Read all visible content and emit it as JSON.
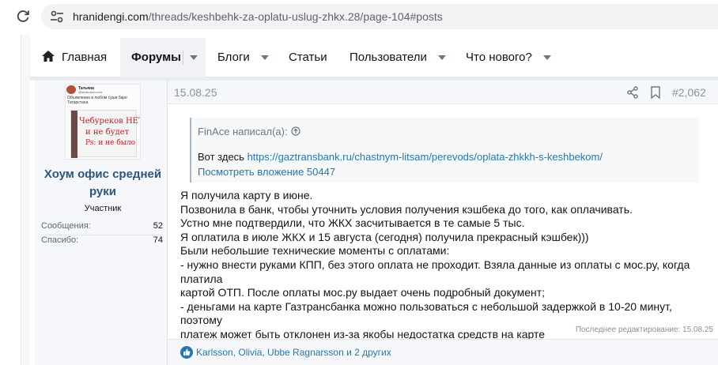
{
  "browser": {
    "url_domain": "hranidengi.com",
    "url_path": "/threads/keshbehk-za-oplatu-uslug-zhkx.28/page-104#posts"
  },
  "nav": {
    "home": "Главная",
    "forums": "Форумы",
    "blogs": "Блоги",
    "articles": "Статьи",
    "users": "Пользователи",
    "whats_new": "Что нового?"
  },
  "author": {
    "avatar_text": {
      "name": "Татьяна",
      "handle": "@tanikodonovna",
      "caption": "Объявление в любом суши баре Татарстана",
      "sign_line1": "Чебуреков НЕТ",
      "sign_line2": "и не будет",
      "sign_line3": "Ps: и не было"
    },
    "name": "Хоум офис средней руки",
    "title": "Участник",
    "stats": [
      {
        "label": "Сообщения:",
        "value": "52"
      },
      {
        "label": "Спасибо:",
        "value": "74"
      }
    ]
  },
  "post": {
    "date": "15.08.25",
    "number": "#2,062",
    "quote": {
      "author_line": "FinAce написал(а):",
      "text_prefix": "Вот здесь ",
      "link": "https://gaztransbank.ru/chastnym-litsam/perevods/oplata-zhkkh-s-keshbekom/",
      "attachment": "Посмотреть вложение 50447"
    },
    "body": [
      "Я получила карту в июне.",
      "Позвонила в банк, чтобы уточнить условия получения кэшбека до того, как оплачивать.",
      "Устно мне подтвердили, что ЖКХ засчитывается в те самые 5 тыс.",
      "Я оплатила в июле ЖКХ и 15 августа (сегодня) получила прекрасный кэшбек)))",
      "Были небольшие технические моменты с оплатами:",
      "- нужно внести руками КПП, без этого оплата не проходит. Взяла данные из оплаты с мос.ру, когда платила",
      "картой ОТП. После оплаты мос.ру выдает очень подробный документ;",
      "- деньгами на карте Газтрансбанка можно пользоваться с небольшой задержкой в 10-20 минут, поэтому",
      "платеж может быть отклонен из-за якобы недостатка средств на карте"
    ],
    "edited": "Последнее редактирование: 15.08.25",
    "reactions": "Karlsson, Olivia, Ubbe Ragnarsson и 2 других"
  },
  "colors": {
    "link": "#2577b1",
    "username": "#2b577f",
    "muted": "#8a939d"
  }
}
